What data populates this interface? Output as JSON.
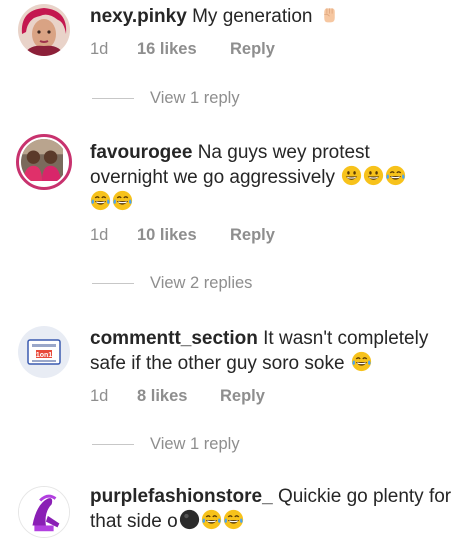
{
  "comments": [
    {
      "username": "nexy.pinky",
      "text": "My generation",
      "emoji": [
        "raised-fist"
      ],
      "time": "1d",
      "likes": "16 likes",
      "reply": "Reply",
      "view_replies": "View 1 reply"
    },
    {
      "username": "favourogee",
      "text": "Na guys wey protest overnight we go  aggressively",
      "emoji": [
        "grinning-face",
        "grinning-face",
        "tears-of-joy",
        "tears-of-joy",
        "tears-of-joy"
      ],
      "time": "1d",
      "likes": "10 likes",
      "reply": "Reply",
      "view_replies": "View 2 replies"
    },
    {
      "username": "commentt_section",
      "text": "It wasn't completely safe if the other guy soro soke",
      "emoji": [
        "tears-of-joy"
      ],
      "time": "1d",
      "likes": "8 likes",
      "reply": "Reply",
      "view_replies": "View 1 reply",
      "avatar_badge": "1on1"
    },
    {
      "username": "purplefashionstore_",
      "text": "Quickie go plenty for that side o",
      "emoji": [
        "black-circle",
        "tears-of-joy",
        "tears-of-joy"
      ]
    }
  ],
  "colors": {
    "text": "#262626",
    "muted": "#8e8e8e",
    "story_ring": "#c8326e",
    "emoji_yellow": "#f7c21b"
  }
}
